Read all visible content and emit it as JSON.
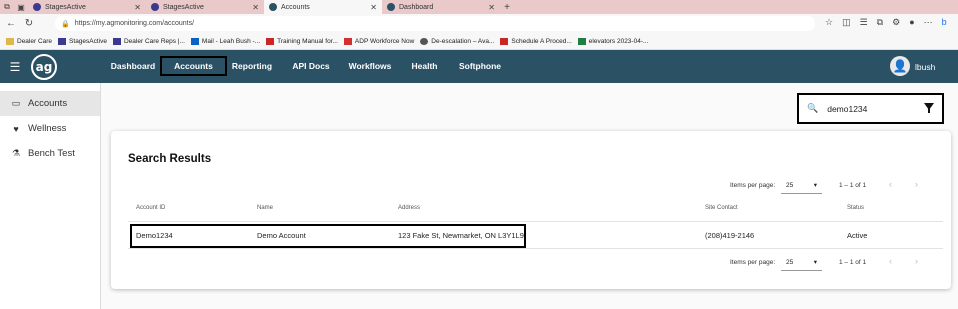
{
  "browser": {
    "tabs": [
      {
        "label": "StagesActive",
        "active": false
      },
      {
        "label": "StagesActive",
        "active": false
      },
      {
        "label": "Accounts",
        "active": true
      },
      {
        "label": "Dashboard",
        "active": false
      }
    ],
    "url": "https://my.agmonitoring.com/accounts/",
    "bookmarks": [
      {
        "label": "Dealer Care",
        "icon": "folder-icon"
      },
      {
        "label": "StagesActive",
        "icon": "stages-icon"
      },
      {
        "label": "Dealer Care Reps |...",
        "icon": "stages-icon"
      },
      {
        "label": "Mail - Leah Bush -...",
        "icon": "outlook-icon"
      },
      {
        "label": "Training Manual for...",
        "icon": "pdf-icon"
      },
      {
        "label": "ADP Workforce Now",
        "icon": "adp-icon"
      },
      {
        "label": "De-escalation – Ava...",
        "icon": "globe-icon"
      },
      {
        "label": "Schedule A Proced...",
        "icon": "pdf-icon"
      },
      {
        "label": "elevators 2023-04-...",
        "icon": "excel-icon"
      }
    ]
  },
  "app": {
    "logo": "ag",
    "nav": [
      "Dashboard",
      "Accounts",
      "Reporting",
      "API Docs",
      "Workflows",
      "Health",
      "Softphone"
    ],
    "active_nav": "Accounts",
    "user": "lbush"
  },
  "sidebar": {
    "items": [
      {
        "label": "Accounts",
        "icon": "id-card-icon",
        "active": true
      },
      {
        "label": "Wellness",
        "icon": "heartbeat-icon",
        "active": false
      },
      {
        "label": "Bench Test",
        "icon": "flask-icon",
        "active": false
      }
    ]
  },
  "search": {
    "value": "demo1234"
  },
  "results": {
    "title": "Search Results",
    "items_per_page_label": "Items per page:",
    "items_per_page": "25",
    "range": "1 – 1 of 1",
    "columns": [
      "Account ID",
      "Name",
      "Address",
      "Site Contact",
      "Status"
    ],
    "rows": [
      {
        "account_id": "Demo1234",
        "name": "Demo Account",
        "address": "123 Fake St, Newmarket, ON L3Y1L9",
        "site_contact": "(208)419-2146",
        "status": "Active"
      }
    ]
  },
  "colors": {
    "appbar": "#2b5165",
    "tabbar": "#e9c9c9"
  }
}
